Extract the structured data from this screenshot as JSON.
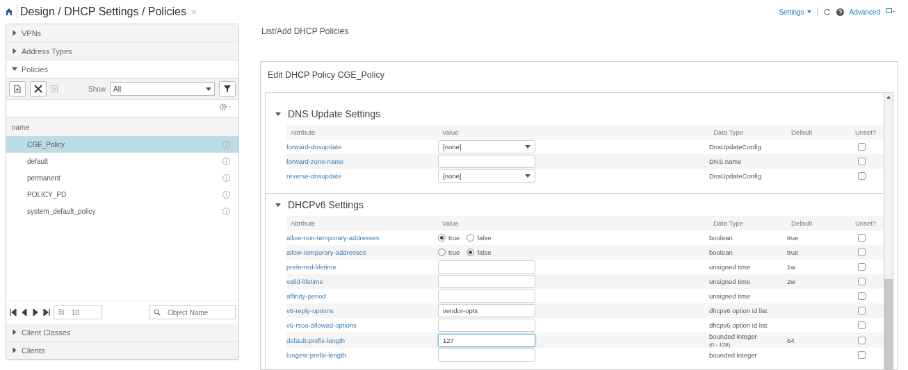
{
  "breadcrumb": {
    "title": "Design / DHCP Settings / Policies",
    "starred": false
  },
  "header_links": {
    "settings": "Settings",
    "advanced": "Advanced"
  },
  "sidebar": {
    "sections_top": [
      {
        "label": "VPNs",
        "expanded": false
      },
      {
        "label": "Address Types",
        "expanded": false
      }
    ],
    "policies": {
      "label": "Policies",
      "expanded": true,
      "show_label": "Show",
      "show_value": "All",
      "column": "name",
      "items": [
        {
          "name": "CGE_Policy",
          "selected": true
        },
        {
          "name": "default",
          "selected": false
        },
        {
          "name": "permanent",
          "selected": false
        },
        {
          "name": "POLICY_PD",
          "selected": false
        },
        {
          "name": "system_default_policy",
          "selected": false
        }
      ],
      "page_size": "10",
      "search_placeholder": "Object Name"
    },
    "sections_bottom": [
      {
        "label": "Client Classes",
        "expanded": false
      },
      {
        "label": "Clients",
        "expanded": false
      }
    ]
  },
  "main": {
    "title": "List/Add DHCP Policies",
    "edit_title": "Edit DHCP Policy CGE_Policy",
    "groups": [
      {
        "title": "DNS Update Settings",
        "expanded": true,
        "columns": [
          "Attribute",
          "Value",
          "Data Type",
          "Default",
          "Unset?"
        ],
        "rows": [
          {
            "attribute": "forward-dnsupdate",
            "kind": "select",
            "value": "[none]",
            "data_type": "DnsUpdateConfig",
            "unset": false
          },
          {
            "attribute": "forward-zone-name",
            "kind": "text",
            "data_type": "DNS name",
            "unset": false
          },
          {
            "attribute": "reverse-dnsupdate",
            "kind": "select",
            "value": "[none]",
            "data_type": "DnsUpdateConfig",
            "unset": false
          }
        ]
      },
      {
        "title": "DHCPv6 Settings",
        "expanded": true,
        "columns": [
          "Attribute",
          "Value",
          "Data Type",
          "Default",
          "Unset?"
        ],
        "rows": [
          {
            "attribute": "allow-non-temporary-addresses",
            "kind": "radio",
            "options": [
              {
                "label": "true",
                "selected": true
              },
              {
                "label": "false",
                "selected": false
              }
            ],
            "data_type": "boolean",
            "default": "true",
            "unset": false
          },
          {
            "attribute": "allow-temporary-addresses",
            "kind": "radio",
            "options": [
              {
                "label": "true",
                "selected": false
              },
              {
                "label": "false",
                "selected": true
              }
            ],
            "data_type": "boolean",
            "default": "true",
            "unset": false
          },
          {
            "attribute": "preferred-lifetime",
            "kind": "text",
            "data_type": "unsigned time",
            "default": "1w",
            "unset": false
          },
          {
            "attribute": "valid-lifetime",
            "kind": "text",
            "data_type": "unsigned time",
            "default": "2w",
            "unset": false
          },
          {
            "attribute": "affinity-period",
            "kind": "text",
            "data_type": "unsigned time",
            "unset": false
          },
          {
            "attribute": "v6-reply-options",
            "kind": "text",
            "value": "vendor-opts",
            "data_type": "dhcpv6 option id list",
            "unset": false
          },
          {
            "attribute": "v6-rsoo-allowed-options",
            "kind": "text",
            "data_type": "dhcpv6 option id list",
            "unset": false
          },
          {
            "attribute": "default-prefix-length",
            "kind": "text",
            "value": "127",
            "focused": true,
            "data_type": "bounded integer",
            "data_type_note": "(0 - 128)",
            "default": "64",
            "unset": false
          },
          {
            "attribute": "longest-prefix-length",
            "kind": "text",
            "focused": false,
            "data_type": "bounded integer",
            "unset": false
          }
        ]
      }
    ]
  }
}
